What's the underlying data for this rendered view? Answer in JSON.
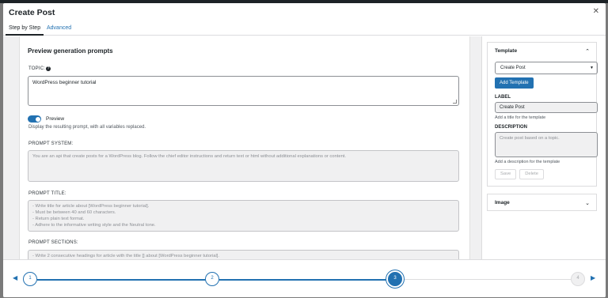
{
  "modal": {
    "title": "Create Post",
    "close_icon": "close-icon"
  },
  "tabs": [
    {
      "label": "Step by Step",
      "active": true
    },
    {
      "label": "Advanced",
      "active": false
    }
  ],
  "main": {
    "section_title": "Preview generation prompts",
    "topic_label": "TOPIC:",
    "topic_value": "WordPress beginner tutorial",
    "preview_label": "Preview",
    "preview_enabled": true,
    "preview_help": "Display the resulting prompt, with all variables replaced.",
    "prompt_system_label": "PROMPT SYSTEM:",
    "prompt_system_value": "You are an api that create posts for a WordPress blog. Follow the chief editor instructions and return text or html without additional explanations or content.",
    "prompt_title_label": "PROMPT TITLE:",
    "prompt_title_lines": [
      "- Write title for article about [WordPress beginner tutorial].",
      "- Must be between 40 and 60 characters.",
      "- Return plain text format.",
      "- Adhere to the informative writing style and the Neutral tone."
    ],
    "prompt_sections_label": "PROMPT SECTIONS:",
    "prompt_sections_lines": [
      "- Write 2 consecutive headings for article with the title [] about [WordPress beginner tutorial]."
    ]
  },
  "sidebar": {
    "template_title": "Template",
    "template_select": "Create Post",
    "add_template_button": "Add Template",
    "label_title": "LABEL",
    "label_value": "Create Post",
    "label_help": "Add a title for the template",
    "description_title": "DESCRIPTION",
    "description_value": "Create post based on a topic.",
    "description_help": "Add a description for the template",
    "save_button": "Save",
    "delete_button": "Delete",
    "image_title": "Image"
  },
  "stepper": {
    "steps": [
      "1",
      "2",
      "3",
      "4"
    ],
    "current_step": 3
  }
}
